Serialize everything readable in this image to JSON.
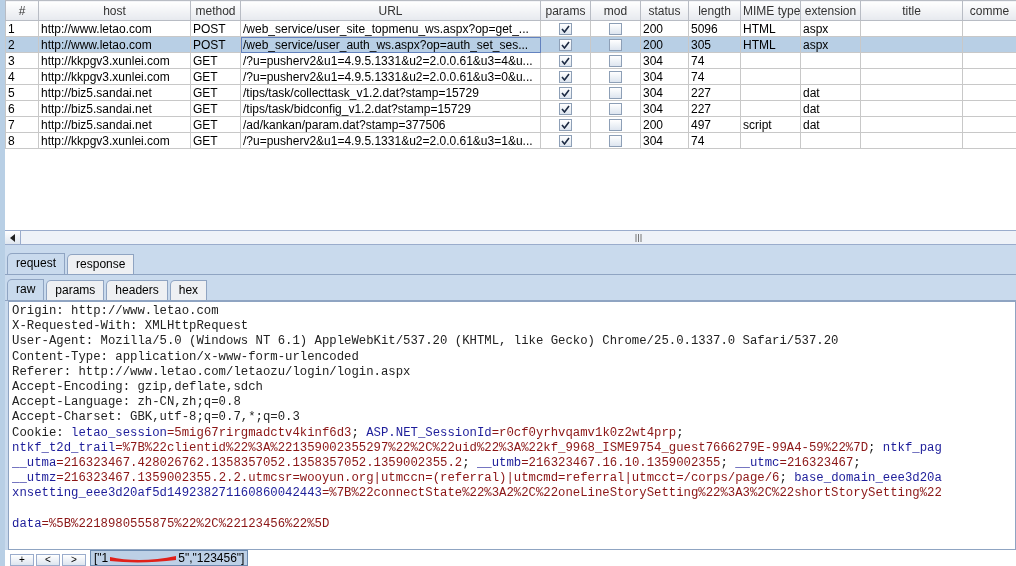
{
  "table": {
    "columns": [
      "#",
      "host",
      "method",
      "URL",
      "params",
      "mod",
      "status",
      "length",
      "MIME type",
      "extension",
      "title",
      "comme"
    ],
    "rows": [
      {
        "cells": [
          "1",
          "http://www.letao.com",
          "POST",
          "/web_service/user_site_topmenu_ws.aspx?op=get_...",
          "",
          "",
          "200",
          "5096",
          "HTML",
          "aspx",
          "",
          ""
        ],
        "params": true,
        "mod": false,
        "selected": false
      },
      {
        "cells": [
          "2",
          "http://www.letao.com",
          "POST",
          "/web_service/user_auth_ws.aspx?op=auth_set_ses...",
          "",
          "",
          "200",
          "305",
          "HTML",
          "aspx",
          "",
          ""
        ],
        "params": true,
        "mod": false,
        "selected": true
      },
      {
        "cells": [
          "3",
          "http://kkpgv3.xunlei.com",
          "GET",
          "/?u=pusherv2&u1=4.9.5.1331&u2=2.0.0.61&u3=4&u...",
          "",
          "",
          "304",
          "74",
          "",
          "",
          "",
          ""
        ],
        "params": true,
        "mod": false,
        "selected": false
      },
      {
        "cells": [
          "4",
          "http://kkpgv3.xunlei.com",
          "GET",
          "/?u=pusherv2&u1=4.9.5.1331&u2=2.0.0.61&u3=0&u...",
          "",
          "",
          "304",
          "74",
          "",
          "",
          "",
          ""
        ],
        "params": true,
        "mod": false,
        "selected": false
      },
      {
        "cells": [
          "5",
          "http://biz5.sandai.net",
          "GET",
          "/tips/task/collecttask_v1.2.dat?stamp=15729",
          "",
          "",
          "304",
          "227",
          "",
          "dat",
          "",
          ""
        ],
        "params": true,
        "mod": false,
        "selected": false
      },
      {
        "cells": [
          "6",
          "http://biz5.sandai.net",
          "GET",
          "/tips/task/bidconfig_v1.2.dat?stamp=15729",
          "",
          "",
          "304",
          "227",
          "",
          "dat",
          "",
          ""
        ],
        "params": true,
        "mod": false,
        "selected": false
      },
      {
        "cells": [
          "7",
          "http://biz5.sandai.net",
          "GET",
          "/ad/kankan/param.dat?stamp=377506",
          "",
          "",
          "200",
          "497",
          "script",
          "dat",
          "",
          ""
        ],
        "params": true,
        "mod": false,
        "selected": false
      },
      {
        "cells": [
          "8",
          "http://kkpgv3.xunlei.com",
          "GET",
          "/?u=pusherv2&u1=4.9.5.1331&u2=2.0.0.61&u3=1&u...",
          "",
          "",
          "304",
          "74",
          "",
          "",
          "",
          ""
        ],
        "params": true,
        "mod": false,
        "selected": false
      }
    ]
  },
  "tabs": [
    {
      "label": "request",
      "selected": true
    },
    {
      "label": "response",
      "selected": false
    }
  ],
  "subtabs": [
    {
      "label": "raw",
      "selected": true
    },
    {
      "label": "params",
      "selected": false
    },
    {
      "label": "headers",
      "selected": false
    },
    {
      "label": "hex",
      "selected": false
    }
  ],
  "raw_lines": [
    {
      "segments": [
        {
          "kind": "plain",
          "text": "Origin: http://www.letao.com"
        }
      ]
    },
    {
      "segments": [
        {
          "kind": "plain",
          "text": "X-Requested-With: XMLHttpRequest"
        }
      ]
    },
    {
      "segments": [
        {
          "kind": "plain",
          "text": "User-Agent: Mozilla/5.0 (Windows NT 6.1) AppleWebKit/537.20 (KHTML, like Gecko) Chrome/25.0.1337.0 Safari/537.20"
        }
      ]
    },
    {
      "segments": [
        {
          "kind": "plain",
          "text": "Content-Type: application/x-www-form-urlencoded"
        }
      ]
    },
    {
      "segments": [
        {
          "kind": "plain",
          "text": "Referer: http://www.letao.com/letaozu/login/login.aspx"
        }
      ]
    },
    {
      "segments": [
        {
          "kind": "plain",
          "text": "Accept-Encoding: gzip,deflate,sdch"
        }
      ]
    },
    {
      "segments": [
        {
          "kind": "plain",
          "text": "Accept-Language: zh-CN,zh;q=0.8"
        }
      ]
    },
    {
      "segments": [
        {
          "kind": "plain",
          "text": "Accept-Charset: GBK,utf-8;q=0.7,*;q=0.3"
        }
      ]
    },
    {
      "segments": [
        {
          "kind": "plain",
          "text": "Cookie: "
        },
        {
          "kind": "name",
          "text": "letao_session"
        },
        {
          "kind": "value",
          "text": "=5mig67rirgmadctv4kinf6d3"
        },
        {
          "kind": "plain",
          "text": "; "
        },
        {
          "kind": "name",
          "text": "ASP.NET_SessionId"
        },
        {
          "kind": "value",
          "text": "=r0cf0yrhvqamv1k0z2wt4prp"
        },
        {
          "kind": "plain",
          "text": ";"
        }
      ]
    },
    {
      "segments": [
        {
          "kind": "name",
          "text": "ntkf_t2d_trail"
        },
        {
          "kind": "value",
          "text": "=%7B%22clientid%22%3A%221359002355297%22%2C%22uid%22%3A%22kf_9968_ISME9754_guest7666279E-99A4-59%22%7D"
        },
        {
          "kind": "plain",
          "text": "; "
        },
        {
          "kind": "name",
          "text": "ntkf_pag"
        }
      ]
    },
    {
      "segments": [
        {
          "kind": "name",
          "text": "__utma"
        },
        {
          "kind": "value",
          "text": "=216323467.428026762.1358357052.1358357052.1359002355.2"
        },
        {
          "kind": "plain",
          "text": "; "
        },
        {
          "kind": "name",
          "text": "__utmb"
        },
        {
          "kind": "value",
          "text": "=216323467.16.10.1359002355"
        },
        {
          "kind": "plain",
          "text": "; "
        },
        {
          "kind": "name",
          "text": "__utmc"
        },
        {
          "kind": "value",
          "text": "=216323467"
        },
        {
          "kind": "plain",
          "text": ";"
        }
      ]
    },
    {
      "segments": [
        {
          "kind": "name",
          "text": "__utmz"
        },
        {
          "kind": "value",
          "text": "=216323467.1359002355.2.2.utmcsr=wooyun.org|utmccn=(referral)|utmcmd=referral|utmcct=/corps/page/6"
        },
        {
          "kind": "plain",
          "text": "; "
        },
        {
          "kind": "name",
          "text": "base_domain_eee3d20a"
        }
      ]
    },
    {
      "segments": [
        {
          "kind": "name",
          "text": "xnsetting_eee3d20af5d149238271160860042443"
        },
        {
          "kind": "value",
          "text": "=%7B%22connectState%22%3A2%2C%22oneLineStorySetting%22%3A3%2C%22shortStorySetting%22"
        }
      ]
    },
    {
      "blank_before": true,
      "segments": [
        {
          "kind": "name",
          "text": "data"
        },
        {
          "kind": "value",
          "text": "=%5B%2218980555875%22%2C%22123456%22%5D"
        }
      ]
    }
  ],
  "bottom_buttons": [
    "+",
    "<",
    ">"
  ],
  "tooltip": {
    "before": "[\"1",
    "after": "5\",\"123456\"]"
  }
}
